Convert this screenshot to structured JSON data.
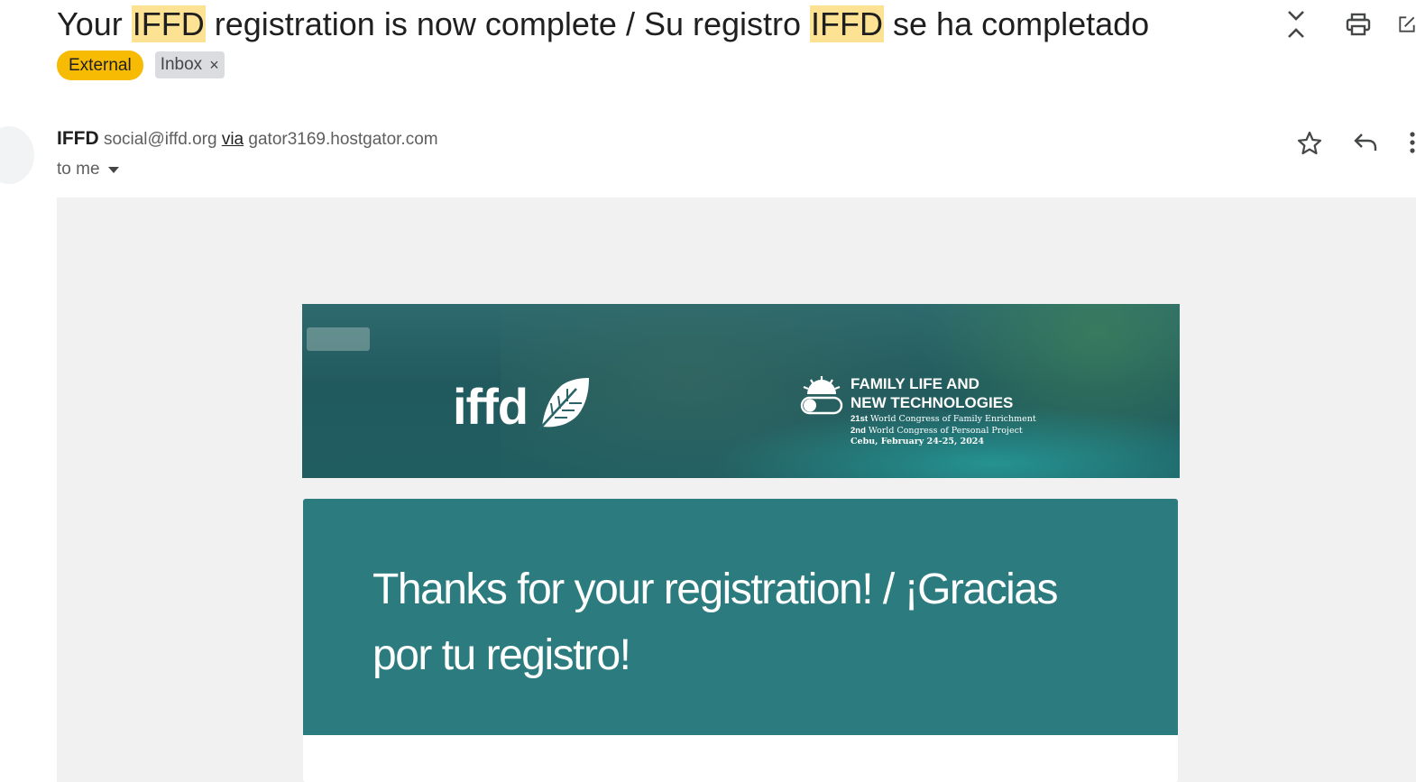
{
  "subject": {
    "part1": "Your ",
    "hl1": "IFFD",
    "part2": " registration is now complete / Su registro ",
    "hl2": "IFFD",
    "part3": " se ha completado"
  },
  "labels": {
    "external": "External",
    "inbox": "Inbox",
    "inbox_remove": "×"
  },
  "sender": {
    "name": "IFFD",
    "email": "social@iffd.org",
    "via": "via",
    "host": "gator3169.hostgator.com",
    "to": "to me"
  },
  "icons": {
    "collapse": "collapse-all-icon",
    "print": "print-icon",
    "popout": "open-in-new-window-icon",
    "star": "star-icon",
    "reply": "reply-icon",
    "more": "more-vert-icon",
    "recipients_dropdown": "caret-down-icon",
    "logo_leaf": "leaf-icon",
    "event_emblem": "sun-toggle-emblem-icon"
  },
  "banner": {
    "logo_text": "iffd",
    "event_title_line1": "FAMILY LIFE AND",
    "event_title_line2": "NEW TECHNOLOGIES",
    "event_line1_bold": "21st",
    "event_line1_rest": " World Congress of Family Enrichment",
    "event_line2_bold": "2nd",
    "event_line2_rest": " World Congress of Personal Project",
    "event_line3": "Cebu, February 24-25, 2024"
  },
  "card": {
    "heading": "Thanks for your registration! / ¡Gracias por tu registro!"
  },
  "colors": {
    "highlight": "#fde293",
    "external_label": "#f7bb04",
    "inbox_label": "#dadce0",
    "card_header": "#2c7b7e",
    "body_bg": "#f1f1f1"
  }
}
